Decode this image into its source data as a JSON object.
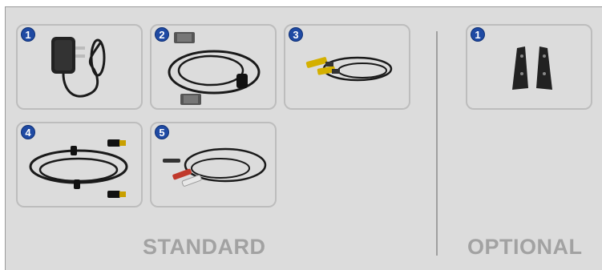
{
  "standard": {
    "label": "STANDARD",
    "items": [
      {
        "number": "1",
        "icon": "power-adapter-icon"
      },
      {
        "number": "2",
        "icon": "vga-cable-icon"
      },
      {
        "number": "3",
        "icon": "rca-cable-icon"
      },
      {
        "number": "4",
        "icon": "hdmi-cable-icon"
      },
      {
        "number": "5",
        "icon": "audio-rca-cable-icon"
      }
    ]
  },
  "optional": {
    "label": "OPTIONAL",
    "items": [
      {
        "number": "1",
        "icon": "mounting-bracket-icon"
      }
    ]
  },
  "colors": {
    "badge": "#1f4aa3",
    "panel": "#dcdcdc",
    "label": "#a2a2a2"
  }
}
